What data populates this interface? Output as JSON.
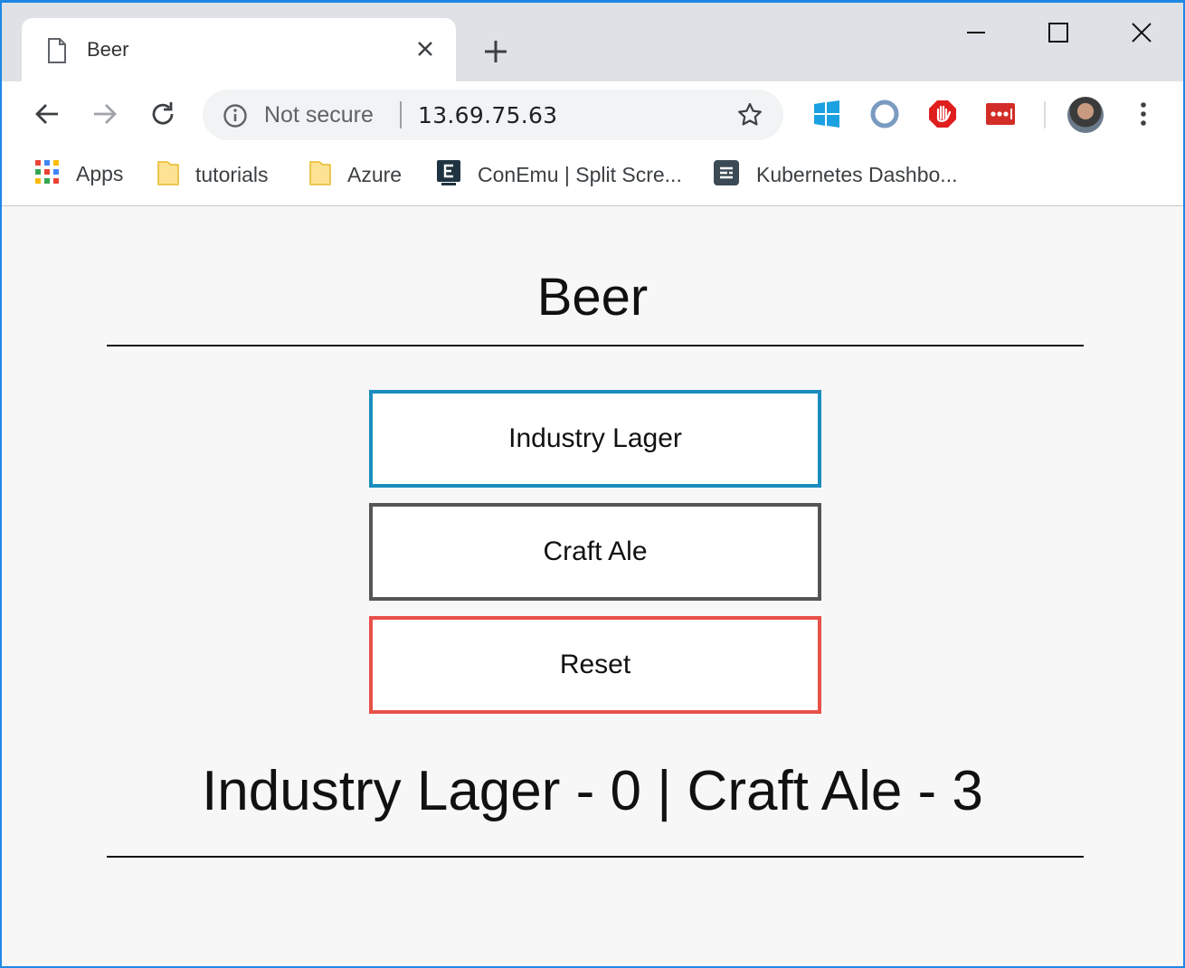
{
  "browser": {
    "tab_title": "Beer",
    "security_label": "Not secure",
    "url": "13.69.75.63",
    "bookmarks": [
      {
        "label": "Apps",
        "icon": "apps-grid-icon"
      },
      {
        "label": "tutorials",
        "icon": "folder-icon"
      },
      {
        "label": "Azure",
        "icon": "folder-icon"
      },
      {
        "label": "ConEmu | Split Scre...",
        "icon": "conemu-icon"
      },
      {
        "label": "Kubernetes Dashbo...",
        "icon": "kubernetes-dashboard-icon"
      }
    ],
    "extensions": [
      "windows-icon",
      "extension-ring-icon",
      "adblock-icon",
      "lastpass-icon"
    ]
  },
  "page": {
    "title": "Beer",
    "buttons": [
      {
        "label": "Industry Lager",
        "border_color": "#1a8dbe"
      },
      {
        "label": "Craft Ale",
        "border_color": "#555555"
      },
      {
        "label": "Reset",
        "border_color": "#e8504a"
      }
    ],
    "results_text": "Industry Lager - 0 | Craft Ale - 3"
  }
}
